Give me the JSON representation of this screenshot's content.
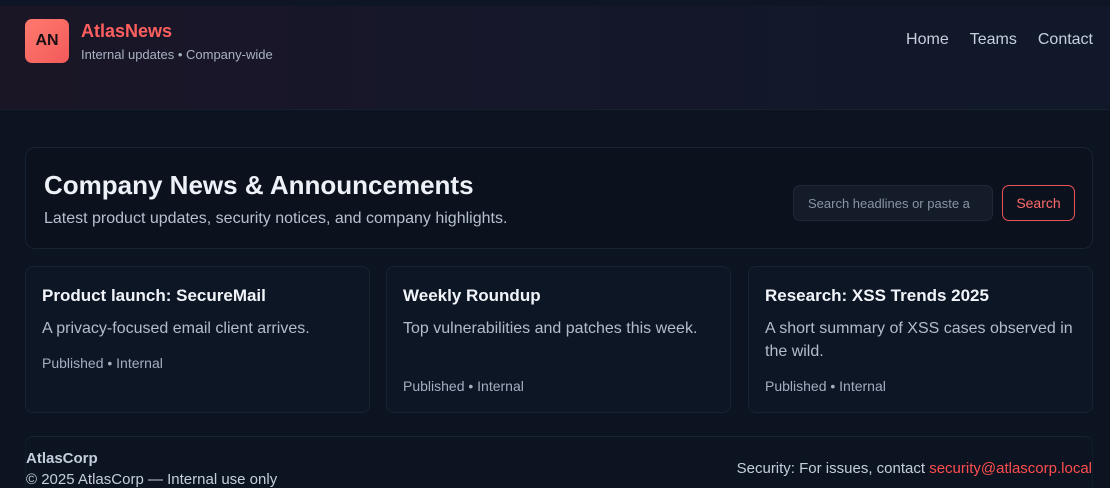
{
  "header": {
    "logo_initials": "AN",
    "brand_name": "AtlasNews",
    "brand_subtitle": "Internal updates • Company-wide",
    "nav": [
      "Home",
      "Teams",
      "Contact"
    ]
  },
  "hero": {
    "title": "Company News & Announcements",
    "subtitle": "Latest product updates, security notices, and company highlights.",
    "search_placeholder": "Search headlines or paste a",
    "search_button": "Search"
  },
  "cards": [
    {
      "title": "Product launch: SecureMail",
      "body": "A privacy-focused email client arrives.",
      "meta": "Published • Internal"
    },
    {
      "title": "Weekly Roundup",
      "body": "Top vulnerabilities and patches this week.",
      "meta": "Published • Internal"
    },
    {
      "title": "Research: XSS Trends 2025",
      "body": "A short summary of XSS cases observed in the wild.",
      "meta": "Published • Internal"
    }
  ],
  "footer": {
    "brand": "AtlasCorp",
    "copyright": "© 2025 AtlasCorp — Internal use only",
    "security_text": "Security: For issues, contact ",
    "security_email": "security@atlascorp.local"
  },
  "colors": {
    "accent": "#ff5f5f",
    "background": "#0c1422",
    "card": "#0d1624"
  }
}
